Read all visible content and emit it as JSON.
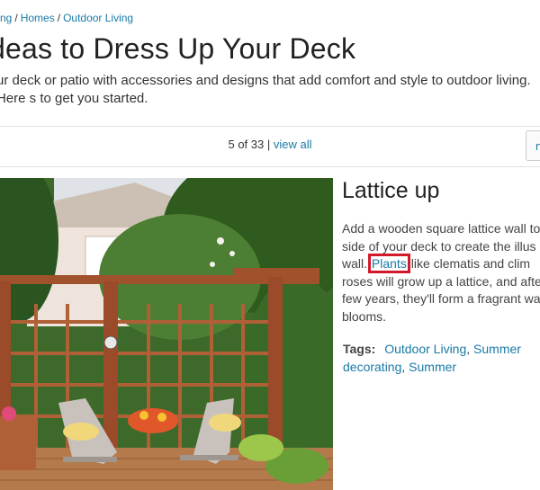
{
  "breadcrumb": {
    "items": [
      "ng",
      "Homes",
      "Outdoor Living"
    ],
    "separator": "/"
  },
  "page": {
    "title": "deas to Dress Up Your Deck",
    "intro": "ur deck or patio with accessories and designs that add comfort and style to outdoor living. Here s to get you started."
  },
  "pager": {
    "position": "5 of 33",
    "divider": "|",
    "view_all": "view all",
    "next_label": "n"
  },
  "slide": {
    "title": "Lattice up",
    "desc_before": "Add a wooden square lattice wall to side of your deck to create the illus a wall. ",
    "desc_link": "Plants",
    "desc_after": " like clematis and clim roses will grow up a lattice, and afte few years, they'll form a fragrant wa blooms."
  },
  "tags": {
    "label": "Tags:",
    "items": [
      "Outdoor Living",
      "Summer decorating",
      "Summer"
    ]
  },
  "colors": {
    "link": "#1a7aa6",
    "highlight": "#d11a2a",
    "wood": "#a0522d"
  }
}
